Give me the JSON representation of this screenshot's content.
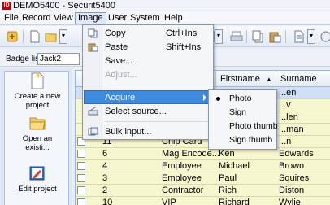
{
  "window": {
    "title": "DEMO5400 - Securit5400",
    "logo_text": "ID"
  },
  "menubar": [
    {
      "label": "File"
    },
    {
      "label": "Record"
    },
    {
      "label": "View"
    },
    {
      "label": "Image"
    },
    {
      "label": "User"
    },
    {
      "label": "System"
    },
    {
      "label": "Help"
    }
  ],
  "badgebar": {
    "label": "Badge list",
    "selected": "Jack2"
  },
  "tasks": [
    {
      "label": "Create a new\nproject"
    },
    {
      "label": "Open an\nexisti..."
    },
    {
      "label": "Edit project"
    }
  ],
  "grid": {
    "headers": [
      "Firstname",
      "Surname"
    ],
    "sort_indicator": "▲",
    "rows": [
      {
        "id": "11",
        "type": "Chip Card",
        "firstname": "",
        "surname": "...n"
      },
      {
        "id": "6",
        "type": "Mag Encode...",
        "firstname": "Ken",
        "surname": "Edwards"
      },
      {
        "id": "4",
        "type": "Employee",
        "firstname": "Michael",
        "surname": "Brown"
      },
      {
        "id": "3",
        "type": "Employee",
        "firstname": "Paul",
        "surname": "Squires"
      },
      {
        "id": "2",
        "type": "Contractor",
        "firstname": "Rich",
        "surname": "Diston"
      },
      {
        "id": "10",
        "type": "VIP",
        "firstname": "Richard",
        "surname": "Wylie"
      }
    ],
    "partial_surnames": [
      "...en",
      "...v",
      "...len",
      "...man"
    ]
  },
  "image_menu": {
    "items": [
      {
        "label": "Copy",
        "shortcut": "Ctrl+Ins",
        "icon": "copy-icon"
      },
      {
        "label": "Paste",
        "shortcut": "Shift+Ins",
        "icon": "paste-icon"
      },
      {
        "label": "Save...",
        "shortcut": ""
      },
      {
        "label": "Adjust...",
        "shortcut": "",
        "disabled": true
      },
      {
        "label": "Acquire",
        "highlighted": true,
        "has_submenu": true
      },
      {
        "label": "Select source...",
        "icon": "scanner-icon"
      },
      {
        "label": "Bulk input...",
        "icon": "bulk-input-icon"
      }
    ]
  },
  "acquire_submenu": {
    "items": [
      {
        "label": "Photo",
        "checked": true
      },
      {
        "label": "Sign"
      },
      {
        "label": "Photo thumb"
      },
      {
        "label": "Sign thumb"
      }
    ]
  },
  "colors": {
    "row_bg": "#f6f6cf",
    "selected_row_bg": "#cfe0f6",
    "menu_highlight": "#3c8be0",
    "logo_red": "#bb0000"
  }
}
